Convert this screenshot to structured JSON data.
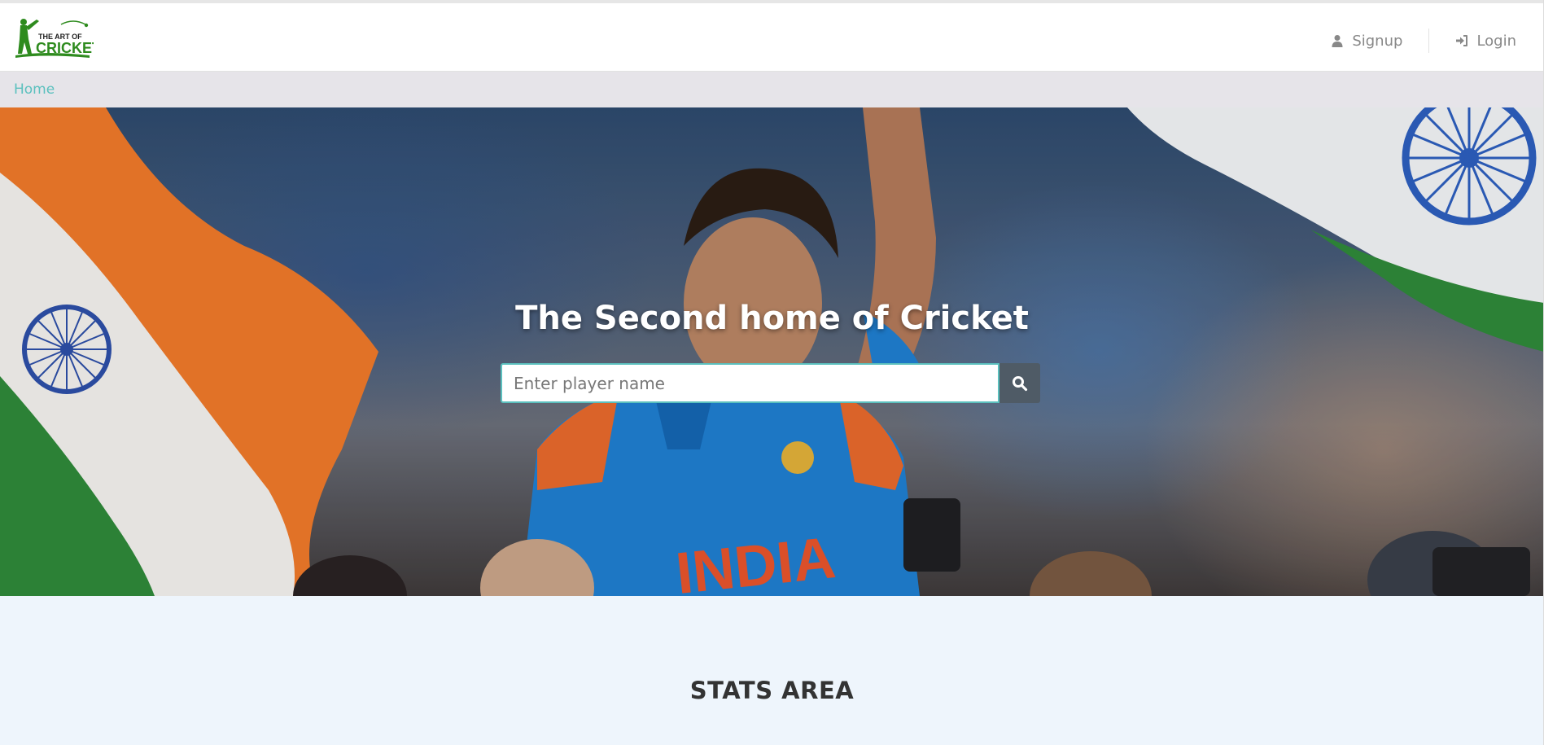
{
  "navbar": {
    "logo_text_top": "THE ART OF",
    "logo_text_bottom": "CRICKET",
    "signup_label": "Signup",
    "login_label": "Login",
    "signup_icon": "user-icon",
    "login_icon": "sign-in-icon"
  },
  "breadcrumb": {
    "home_label": "Home"
  },
  "hero": {
    "title": "The Second home of Cricket",
    "search_placeholder": "Enter player name",
    "search_icon": "search-icon"
  },
  "stats": {
    "title": "STATS AREA"
  },
  "colors": {
    "accent": "#5bc0be",
    "logo_green": "#2e8b1e",
    "breadcrumb_bg": "#e6e4e9",
    "stats_bg": "#eef5fc",
    "search_button": "#4f5b66"
  }
}
